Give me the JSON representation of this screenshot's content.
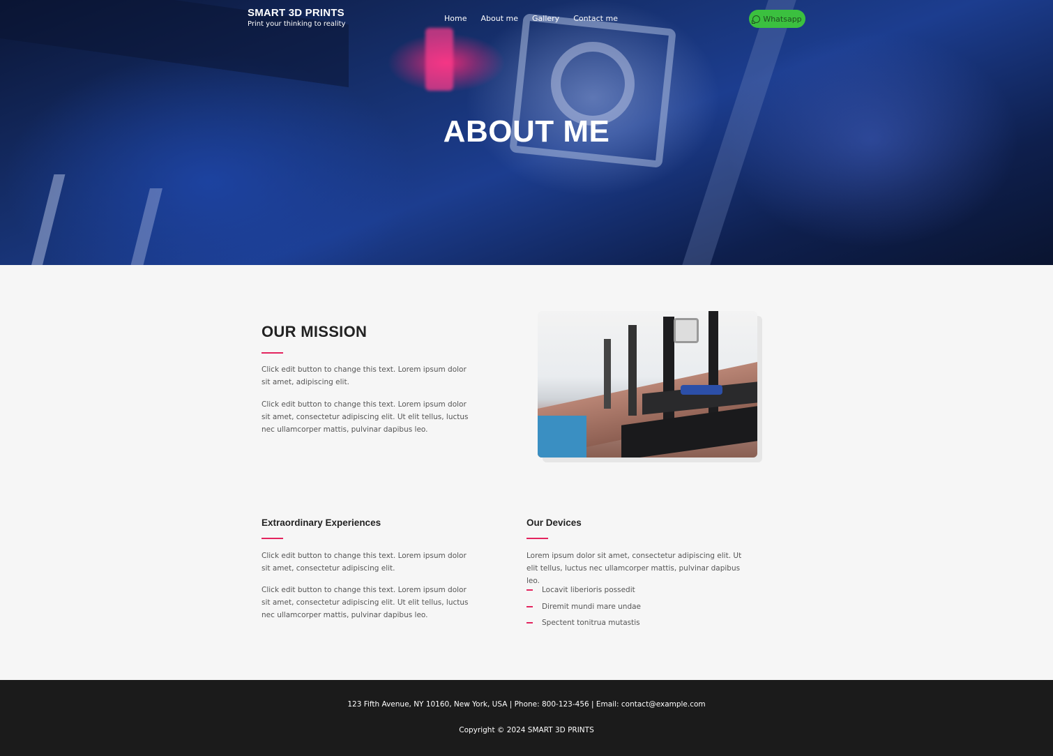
{
  "header": {
    "brand_name": "SMART 3D PRINTS",
    "tagline": "Print your thinking to reality",
    "nav": [
      {
        "label": "Home"
      },
      {
        "label": "About me"
      },
      {
        "label": "Gallery"
      },
      {
        "label": "Contact me"
      }
    ],
    "whatsapp_label": "Whatsapp",
    "whatsapp_color": "#3bc03f"
  },
  "hero": {
    "title": "ABOUT ME"
  },
  "mission": {
    "heading": "OUR MISSION",
    "paragraphs": [
      "Click edit button to change this text. Lorem ipsum dolor sit amet, adipiscing elit.",
      "Click edit button to change this text. Lorem ipsum dolor sit amet, consectetur adipiscing elit. Ut elit tellus, luctus nec ullamcorper mattis, pulvinar dapibus leo."
    ]
  },
  "experiences": {
    "heading": "Extraordinary Experiences",
    "paragraphs": [
      "Click edit button to change this text. Lorem ipsum dolor sit amet, consectetur adipiscing elit.",
      "Click edit button to change this text. Lorem ipsum dolor sit amet, consectetur adipiscing elit. Ut elit tellus, luctus nec ullamcorper mattis, pulvinar dapibus leo."
    ]
  },
  "devices": {
    "heading": "Our Devices",
    "intro": "Lorem ipsum dolor sit amet, consectetur adipiscing elit. Ut elit tellus, luctus nec ullamcorper mattis, pulvinar dapibus leo.",
    "items": [
      "Locavit liberioris possedit",
      "Diremit mundi mare undae",
      "Spectent tonitrua mutastis"
    ]
  },
  "footer": {
    "contact": "123 Fifth Avenue, NY 10160, New York, USA | Phone: 800-123-456 | Email: contact@example.com",
    "copyright": "Copyright © 2024 SMART 3D PRINTS"
  },
  "colors": {
    "accent": "#e3245e",
    "footer_bg": "#1b1b1b",
    "page_bg": "#f6f6f6"
  }
}
